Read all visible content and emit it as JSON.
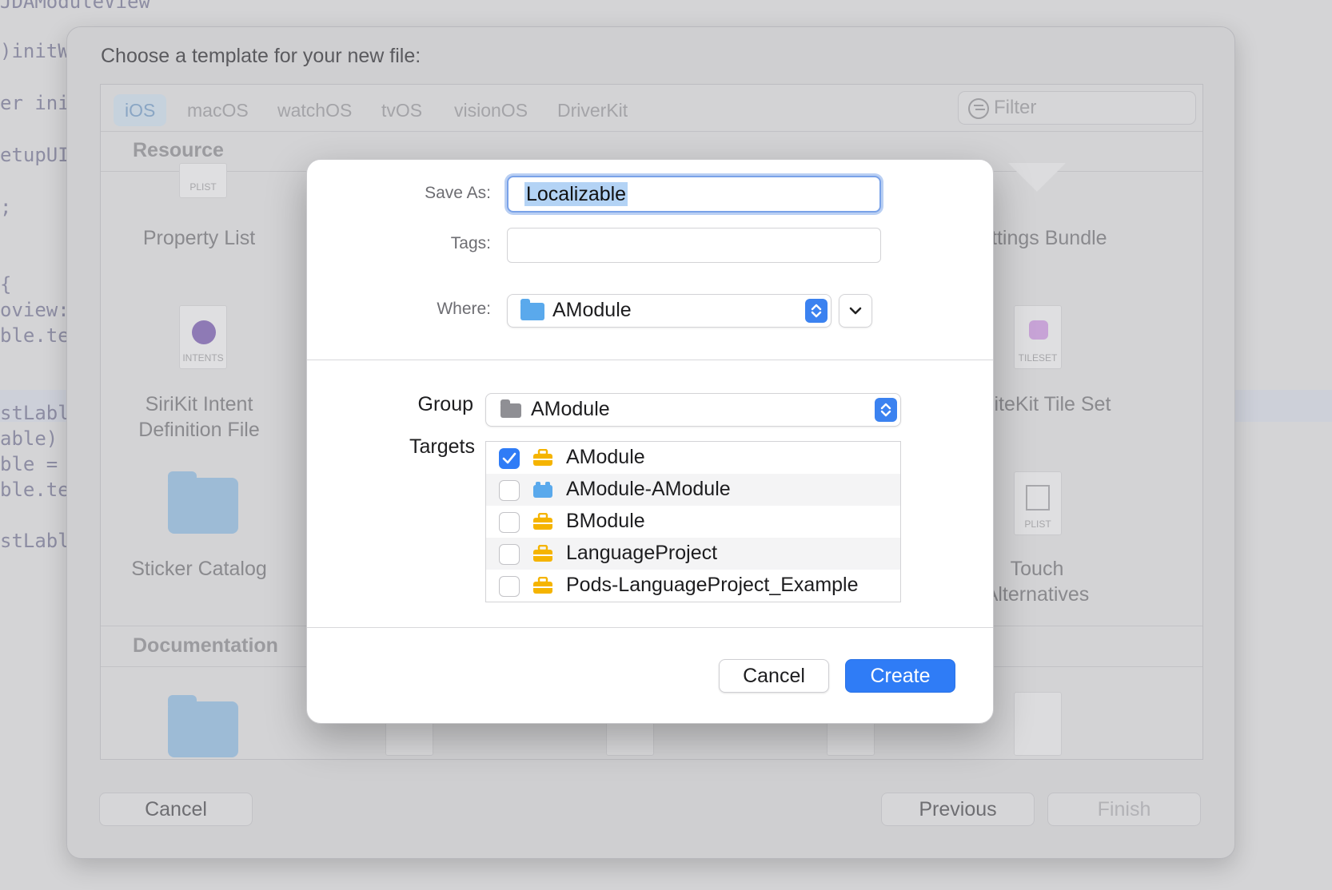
{
  "code_editor": {
    "lines": [
      "JDAModuleView",
      ")initW",
      "er ini",
      "etupUI",
      ";",
      "{",
      "oview:",
      "ble.te",
      "stLabl",
      "able)",
      "ble =",
      "ble.te",
      "stLabl"
    ]
  },
  "template_sheet": {
    "title": "Choose a template for your new file:",
    "tabs": [
      "iOS",
      "macOS",
      "watchOS",
      "tvOS",
      "visionOS",
      "DriverKit"
    ],
    "active_tab": "iOS",
    "filter_placeholder": "Filter",
    "sections": {
      "resource": "Resource",
      "documentation": "Documentation"
    },
    "items": {
      "property_list": "Property List",
      "property_list_cap": "PLIST",
      "sirikit_line1": "SiriKit Intent",
      "sirikit_line2": "Definition File",
      "intents_cap": "INTENTS",
      "sticker_catalog": "Sticker Catalog",
      "settings_bundle": "Settings Bundle",
      "spritekit_tile_set": "SpriteKit Tile Set",
      "tileset_cap": "TILESET",
      "touch_line1": "Touch",
      "touch_line2": "Alternatives",
      "touch_cap": "PLIST"
    },
    "buttons": {
      "cancel": "Cancel",
      "previous": "Previous",
      "finish": "Finish"
    }
  },
  "save_dialog": {
    "save_as_label": "Save As:",
    "save_as_value": "Localizable",
    "tags_label": "Tags:",
    "tags_value": "",
    "where_label": "Where:",
    "where_value": "AModule",
    "group_label": "Group",
    "group_value": "AModule",
    "targets_label": "Targets",
    "targets": [
      {
        "name": "AModule",
        "checked": true,
        "icon": "toolbox-icon",
        "color": "#f5b400"
      },
      {
        "name": "AModule-AModule",
        "checked": false,
        "icon": "bundle-icon",
        "color": "#5aa9ec"
      },
      {
        "name": "BModule",
        "checked": false,
        "icon": "toolbox-icon",
        "color": "#f5b400"
      },
      {
        "name": "LanguageProject",
        "checked": false,
        "icon": "toolbox-icon",
        "color": "#f5b400"
      },
      {
        "name": "Pods-LanguageProject_Example",
        "checked": false,
        "icon": "toolbox-icon",
        "color": "#f5b400"
      }
    ],
    "cancel_label": "Cancel",
    "create_label": "Create"
  },
  "colors": {
    "accent": "#2f7cf6",
    "target_icon": "#f5b400",
    "folder": "#5aa9ec"
  }
}
